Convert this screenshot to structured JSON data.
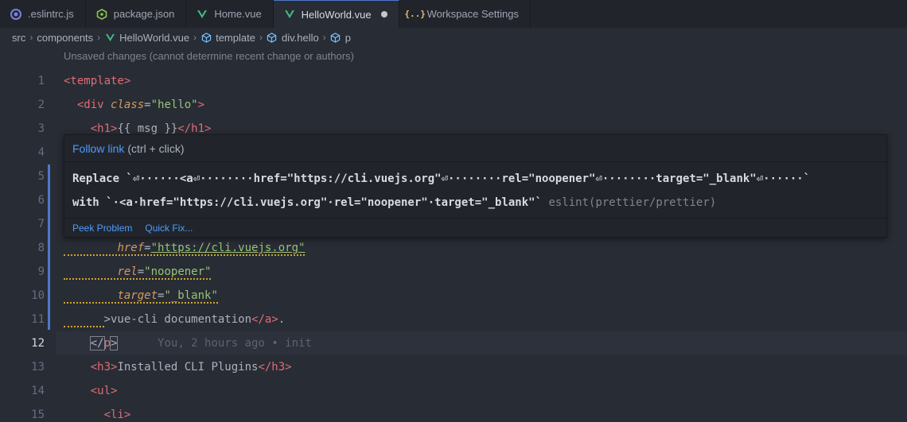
{
  "tabs": [
    {
      "label": ".eslintrc.js",
      "icon": "eslint-icon",
      "active": false
    },
    {
      "label": "package.json",
      "icon": "nodejs-icon",
      "active": false
    },
    {
      "label": "Home.vue",
      "icon": "vue-icon",
      "active": false
    },
    {
      "label": "HelloWorld.vue",
      "icon": "vue-icon",
      "active": true,
      "modified": true
    },
    {
      "label": "Workspace Settings",
      "icon": "json-braces-icon",
      "active": false
    }
  ],
  "breadcrumb": {
    "items": [
      "src",
      "components",
      "HelloWorld.vue",
      "template",
      "div.hello",
      "p"
    ]
  },
  "editor": {
    "codelens": "Unsaved changes (cannot determine recent change or authors)",
    "line_numbers": [
      "1",
      "2",
      "3",
      "4",
      "5",
      "6",
      "7",
      "8",
      "9",
      "10",
      "11",
      "12",
      "13",
      "14",
      "15"
    ],
    "current_line": "12",
    "blame": "You, 2 hours ago • init"
  },
  "hover": {
    "link_text": "Follow link",
    "link_hint": "(ctrl + click)",
    "message_line1": "Replace `⏎······<a⏎········href=\"https://cli.vuejs.org\"⏎········rel=\"noopener\"⏎········target=\"_blank\"⏎······`",
    "message_line2": "with `·<a·href=\"https://cli.vuejs.org\"·rel=\"noopener\"·target=\"_blank\"`",
    "source": "eslint(prettier/prettier)",
    "peek_problem": "Peek Problem",
    "quick_fix": "Quick Fix..."
  },
  "colors": {
    "tag": "#e06c75",
    "attribute": "#d19a66",
    "string": "#98c379",
    "link": "#4d9cff",
    "accent": "#4d78cc"
  }
}
